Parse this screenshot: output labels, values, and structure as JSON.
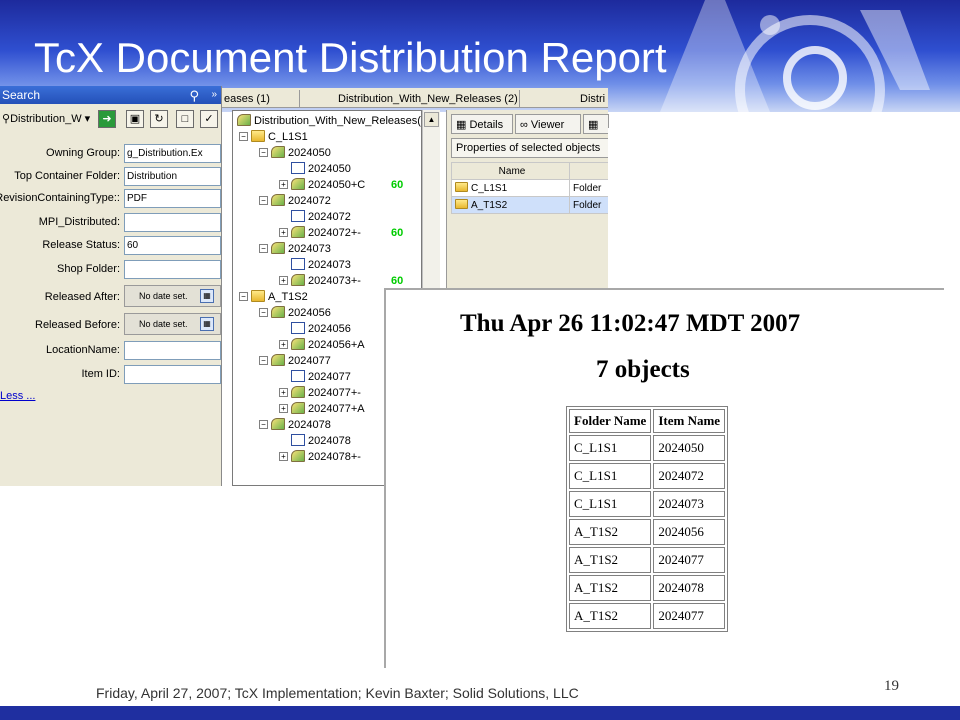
{
  "slide": {
    "title": "TcX Document Distribution Report",
    "footer": "Friday, April 27, 2007; TcX Implementation; Kevin Baxter; Solid Solutions, LLC",
    "page_number": "19",
    "colors": {
      "header_band": "#2f4fd0",
      "footer_band": "#1f2fa0",
      "title_text": "#ffffff"
    }
  },
  "search": {
    "title": "Search",
    "query_name": "Distribution_W",
    "fields": [
      {
        "label": "Owning Group:",
        "value": "g_Distribution.Ex"
      },
      {
        "label": "Top Container Folder:",
        "value": "Distribution"
      },
      {
        "label": "RevisionContainingType::",
        "value": "PDF"
      },
      {
        "label": "MPI_Distributed:",
        "value": ""
      },
      {
        "label": "Release Status:",
        "value": "60"
      },
      {
        "label": "Shop Folder:",
        "value": ""
      },
      {
        "label": "Released After:",
        "value": "No date set."
      },
      {
        "label": "Released Before:",
        "value": "No date set."
      },
      {
        "label": "LocationName:",
        "value": ""
      },
      {
        "label": "Item ID:",
        "value": ""
      }
    ],
    "less_link": "Less ..."
  },
  "tabs": [
    {
      "label": "eases (1)"
    },
    {
      "label": "Distribution_With_New_Releases (2)"
    },
    {
      "label": "Distri"
    }
  ],
  "tree": {
    "root": "Distribution_With_New_Releases(",
    "status_value": "60",
    "nodes": [
      {
        "label": "C_L1S1",
        "type": "folder",
        "level": 1
      },
      {
        "label": "2024050",
        "type": "item",
        "level": 2
      },
      {
        "label": "2024050",
        "type": "doc",
        "level": 3
      },
      {
        "label": "2024050+C",
        "type": "rev",
        "level": 3,
        "status": true
      },
      {
        "label": "2024072",
        "type": "item",
        "level": 2
      },
      {
        "label": "2024072",
        "type": "doc",
        "level": 3
      },
      {
        "label": "2024072+-",
        "type": "rev",
        "level": 3,
        "status": true
      },
      {
        "label": "2024073",
        "type": "item",
        "level": 2
      },
      {
        "label": "2024073",
        "type": "doc",
        "level": 3
      },
      {
        "label": "2024073+-",
        "type": "rev",
        "level": 3,
        "status": true
      },
      {
        "label": "A_T1S2",
        "type": "folder",
        "level": 1
      },
      {
        "label": "2024056",
        "type": "item",
        "level": 2
      },
      {
        "label": "2024056",
        "type": "doc",
        "level": 3
      },
      {
        "label": "2024056+A",
        "type": "rev",
        "level": 3
      },
      {
        "label": "2024077",
        "type": "item",
        "level": 2
      },
      {
        "label": "2024077",
        "type": "doc",
        "level": 3
      },
      {
        "label": "2024077+-",
        "type": "rev",
        "level": 3
      },
      {
        "label": "2024077+A",
        "type": "rev",
        "level": 3
      },
      {
        "label": "2024078",
        "type": "item",
        "level": 2
      },
      {
        "label": "2024078",
        "type": "doc",
        "level": 3
      },
      {
        "label": "2024078+-",
        "type": "rev",
        "level": 3
      }
    ]
  },
  "details": {
    "tabs": [
      "Details",
      "Viewer"
    ],
    "properties_header": "Properties of selected objects",
    "columns": [
      "Name",
      ""
    ],
    "rows": [
      {
        "name": "C_L1S1",
        "type": "Folder",
        "selected": false
      },
      {
        "name": "A_T1S2",
        "type": "Folder",
        "selected": true
      }
    ]
  },
  "report": {
    "date": "Thu Apr 26 11:02:47 MDT 2007",
    "count": "7 objects",
    "columns": [
      "Folder Name",
      "Item Name"
    ],
    "rows": [
      [
        "C_L1S1",
        "2024050"
      ],
      [
        "C_L1S1",
        "2024072"
      ],
      [
        "C_L1S1",
        "2024073"
      ],
      [
        "A_T1S2",
        "2024056"
      ],
      [
        "A_T1S2",
        "2024077"
      ],
      [
        "A_T1S2",
        "2024078"
      ],
      [
        "A_T1S2",
        "2024077"
      ]
    ]
  }
}
